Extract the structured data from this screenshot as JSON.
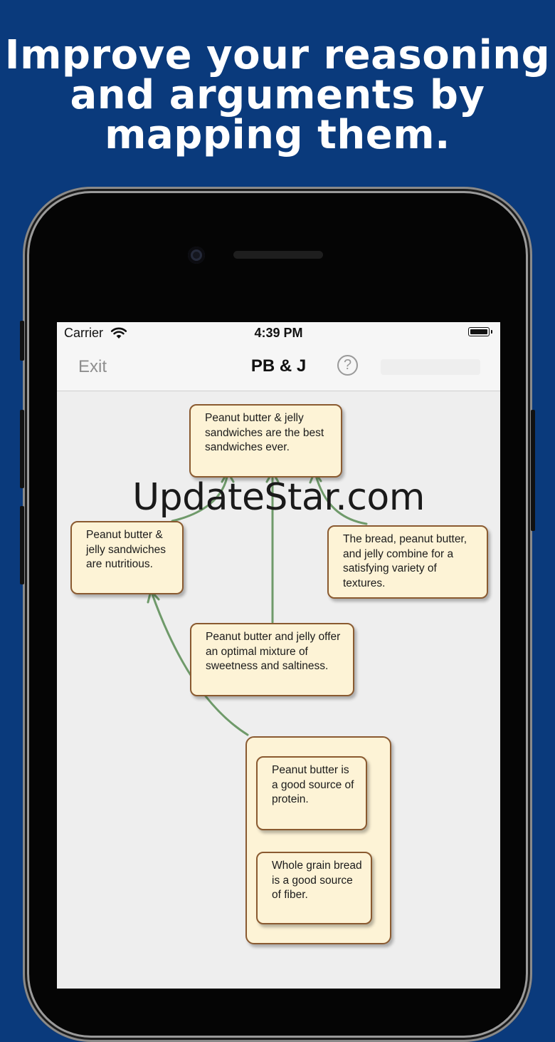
{
  "headline": {
    "line1": "Improve your reasoning",
    "line2": "and arguments by",
    "line3": "mapping them."
  },
  "status_bar": {
    "carrier": "Carrier",
    "time": "4:39 PM",
    "wifi_icon": "wifi-icon",
    "battery_icon": "battery-icon"
  },
  "nav": {
    "exit_label": "Exit",
    "title": "PB & J",
    "help_label": "?",
    "help_icon": "question-circle-icon"
  },
  "map": {
    "claim": "Peanut butter & jelly sandwiches are the best sandwiches ever.",
    "reason_nutritious": "Peanut butter & jelly sandwiches are nutritious.",
    "reason_textures": "The bread, peanut butter, and jelly combine for a satisfying variety of textures.",
    "reason_sweetness": "Peanut butter and jelly offer an optimal mixture of sweetness and saltiness.",
    "evidence_protein": "Peanut butter is a good source of protein.",
    "evidence_fiber": "Whole grain bread is a good source of fiber."
  },
  "colors": {
    "background": "#0a3a7c",
    "card_fill": "#fdf3d6",
    "card_border": "#8a5a30",
    "connector": "#6f9a6a"
  },
  "watermark": "UpdateStar.com"
}
